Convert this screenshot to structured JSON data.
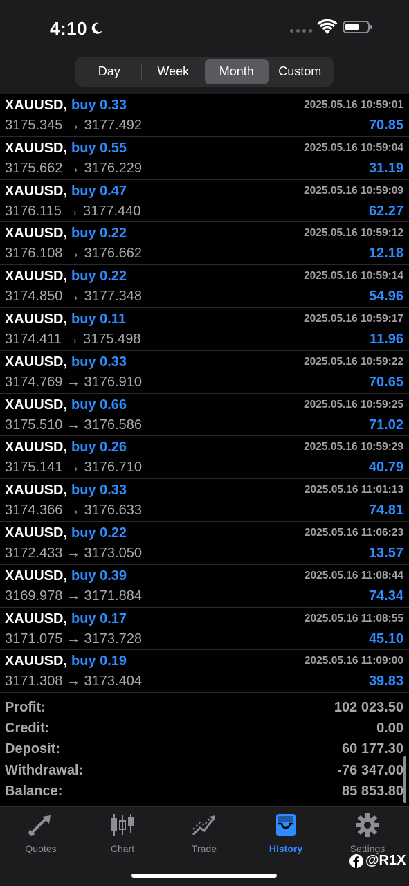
{
  "status": {
    "time": "4:10"
  },
  "segments": [
    {
      "label": "Day",
      "active": false
    },
    {
      "label": "Week",
      "active": false
    },
    {
      "label": "Month",
      "active": true
    },
    {
      "label": "Custom",
      "active": false
    }
  ],
  "deals": [
    {
      "symbol": "XAUUSD,",
      "side": "buy 0.33",
      "time": "2025.05.16 10:59:01",
      "prices": "3175.345 → 3177.492",
      "profit": "70.85"
    },
    {
      "symbol": "XAUUSD,",
      "side": "buy 0.55",
      "time": "2025.05.16 10:59:04",
      "prices": "3175.662 → 3176.229",
      "profit": "31.19"
    },
    {
      "symbol": "XAUUSD,",
      "side": "buy 0.47",
      "time": "2025.05.16 10:59:09",
      "prices": "3176.115 → 3177.440",
      "profit": "62.27"
    },
    {
      "symbol": "XAUUSD,",
      "side": "buy 0.22",
      "time": "2025.05.16 10:59:12",
      "prices": "3176.108 → 3176.662",
      "profit": "12.18"
    },
    {
      "symbol": "XAUUSD,",
      "side": "buy 0.22",
      "time": "2025.05.16 10:59:14",
      "prices": "3174.850 → 3177.348",
      "profit": "54.96"
    },
    {
      "symbol": "XAUUSD,",
      "side": "buy 0.11",
      "time": "2025.05.16 10:59:17",
      "prices": "3174.411 → 3175.498",
      "profit": "11.96"
    },
    {
      "symbol": "XAUUSD,",
      "side": "buy 0.33",
      "time": "2025.05.16 10:59:22",
      "prices": "3174.769 → 3176.910",
      "profit": "70.65"
    },
    {
      "symbol": "XAUUSD,",
      "side": "buy 0.66",
      "time": "2025.05.16 10:59:25",
      "prices": "3175.510 → 3176.586",
      "profit": "71.02"
    },
    {
      "symbol": "XAUUSD,",
      "side": "buy 0.26",
      "time": "2025.05.16 10:59:29",
      "prices": "3175.141 → 3176.710",
      "profit": "40.79"
    },
    {
      "symbol": "XAUUSD,",
      "side": "buy 0.33",
      "time": "2025.05.16 11:01:13",
      "prices": "3174.366 → 3176.633",
      "profit": "74.81"
    },
    {
      "symbol": "XAUUSD,",
      "side": "buy 0.22",
      "time": "2025.05.16 11:06:23",
      "prices": "3172.433 → 3173.050",
      "profit": "13.57"
    },
    {
      "symbol": "XAUUSD,",
      "side": "buy 0.39",
      "time": "2025.05.16 11:08:44",
      "prices": "3169.978 → 3171.884",
      "profit": "74.34"
    },
    {
      "symbol": "XAUUSD,",
      "side": "buy 0.17",
      "time": "2025.05.16 11:08:55",
      "prices": "3171.075 → 3173.728",
      "profit": "45.10"
    },
    {
      "symbol": "XAUUSD,",
      "side": "buy 0.19",
      "time": "2025.05.16 11:09:00",
      "prices": "3171.308 → 3173.404",
      "profit": "39.83"
    }
  ],
  "summary": [
    {
      "label": "Profit:",
      "value": "102 023.50"
    },
    {
      "label": "Credit:",
      "value": "0.00"
    },
    {
      "label": "Deposit:",
      "value": "60 177.30"
    },
    {
      "label": "Withdrawal:",
      "value": "-76 347.00"
    },
    {
      "label": "Balance:",
      "value": "85 853.80"
    }
  ],
  "tabs": [
    {
      "label": "Quotes",
      "icon": "quotes-icon",
      "active": false
    },
    {
      "label": "Chart",
      "icon": "chart-icon",
      "active": false
    },
    {
      "label": "Trade",
      "icon": "trade-icon",
      "active": false
    },
    {
      "label": "History",
      "icon": "history-icon",
      "active": true
    },
    {
      "label": "Settings",
      "icon": "settings-icon",
      "active": false
    }
  ],
  "watermark": "@R1X",
  "colors": {
    "accent": "#2f8cff",
    "background": "#000000",
    "bar": "#1c1c1e",
    "muted": "#a8a8ad"
  }
}
